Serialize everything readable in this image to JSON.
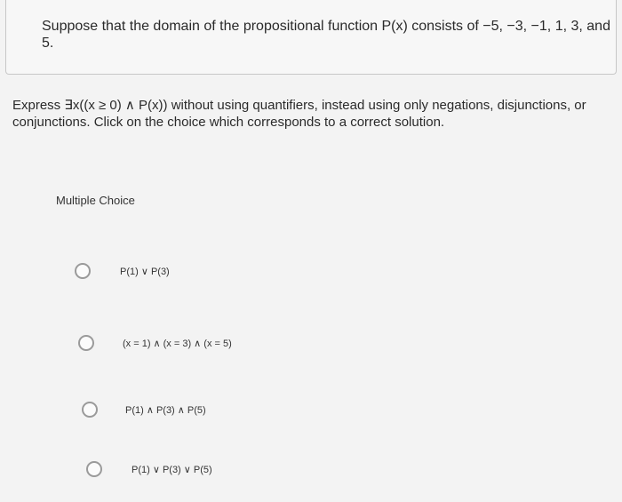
{
  "premise": "Suppose that the domain of the propositional function P(x) consists of −5, −3, −1, 1, 3, and 5.",
  "question": "Express ∃x((x ≥ 0) ∧ P(x)) without using quantifiers, instead using only negations, disjunctions, or conjunctions. Click on the choice which corresponds to a correct solution.",
  "section_label": "Multiple Choice",
  "choices": [
    {
      "label": "P(1) ∨ P(3)"
    },
    {
      "label": "(x = 1) ∧ (x = 3) ∧ (x = 5)"
    },
    {
      "label": "P(1) ∧ P(3) ∧ P(5)"
    },
    {
      "label": "P(1) ∨ P(3) ∨ P(5)"
    }
  ]
}
